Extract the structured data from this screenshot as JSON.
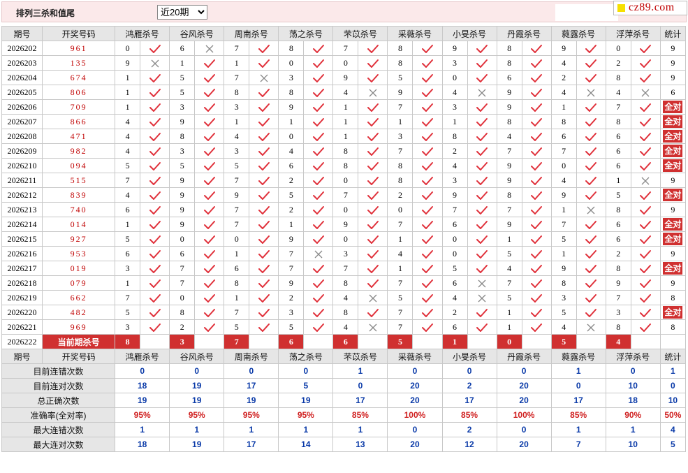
{
  "header": {
    "title": "排列三杀和值尾",
    "range_select": "近20期",
    "logo_text": "cz89.com"
  },
  "columns": {
    "period": "期号",
    "draw": "开奖号码",
    "experts": [
      "鸿雁杀号",
      "谷风杀号",
      "周南杀号",
      "荡之杀号",
      "芣苡杀号",
      "采薇杀号",
      "小旻杀号",
      "丹霞杀号",
      "蕤露杀号",
      "浮萍杀号"
    ],
    "total": "统计"
  },
  "rows": [
    {
      "period": "2026202",
      "draw": "961",
      "n": [
        0,
        6,
        7,
        8,
        7,
        8,
        9,
        8,
        9,
        0
      ],
      "ok": [
        1,
        0,
        1,
        1,
        1,
        1,
        1,
        1,
        1,
        1
      ],
      "total": "9"
    },
    {
      "period": "2026203",
      "draw": "135",
      "n": [
        9,
        1,
        1,
        0,
        0,
        8,
        3,
        8,
        4,
        2
      ],
      "ok": [
        0,
        1,
        1,
        1,
        1,
        1,
        1,
        1,
        1,
        1
      ],
      "total": "9"
    },
    {
      "period": "2026204",
      "draw": "674",
      "n": [
        1,
        5,
        7,
        3,
        9,
        5,
        0,
        6,
        2,
        8
      ],
      "ok": [
        1,
        1,
        0,
        1,
        1,
        1,
        1,
        1,
        1,
        1
      ],
      "total": "9"
    },
    {
      "period": "2026205",
      "draw": "806",
      "n": [
        1,
        5,
        8,
        8,
        4,
        9,
        4,
        9,
        4,
        4
      ],
      "ok": [
        1,
        1,
        1,
        1,
        0,
        1,
        0,
        1,
        0,
        0
      ],
      "total": "6"
    },
    {
      "period": "2026206",
      "draw": "709",
      "n": [
        1,
        3,
        3,
        9,
        1,
        7,
        3,
        9,
        1,
        7
      ],
      "ok": [
        1,
        1,
        1,
        1,
        1,
        1,
        1,
        1,
        1,
        1
      ],
      "total": "全对"
    },
    {
      "period": "2026207",
      "draw": "866",
      "n": [
        4,
        9,
        1,
        1,
        1,
        1,
        1,
        8,
        8,
        8
      ],
      "ok": [
        1,
        1,
        1,
        1,
        1,
        1,
        1,
        1,
        1,
        1
      ],
      "total": "全对"
    },
    {
      "period": "2026208",
      "draw": "471",
      "n": [
        4,
        8,
        4,
        0,
        1,
        3,
        8,
        4,
        6,
        6
      ],
      "ok": [
        1,
        1,
        1,
        1,
        1,
        1,
        1,
        1,
        1,
        1
      ],
      "total": "全对"
    },
    {
      "period": "2026209",
      "draw": "982",
      "n": [
        4,
        3,
        3,
        4,
        8,
        7,
        2,
        7,
        7,
        6
      ],
      "ok": [
        1,
        1,
        1,
        1,
        1,
        1,
        1,
        1,
        1,
        1
      ],
      "total": "全对"
    },
    {
      "period": "2026210",
      "draw": "094",
      "n": [
        5,
        5,
        5,
        6,
        8,
        8,
        4,
        9,
        0,
        6
      ],
      "ok": [
        1,
        1,
        1,
        1,
        1,
        1,
        1,
        1,
        1,
        1
      ],
      "total": "全对"
    },
    {
      "period": "2026211",
      "draw": "515",
      "n": [
        7,
        9,
        7,
        2,
        0,
        8,
        3,
        9,
        4,
        1
      ],
      "ok": [
        1,
        1,
        1,
        1,
        1,
        1,
        1,
        1,
        1,
        0
      ],
      "total": "9"
    },
    {
      "period": "2026212",
      "draw": "839",
      "n": [
        4,
        9,
        9,
        5,
        7,
        2,
        9,
        8,
        9,
        5
      ],
      "ok": [
        1,
        1,
        1,
        1,
        1,
        1,
        1,
        1,
        1,
        1
      ],
      "total": "全对"
    },
    {
      "period": "2026213",
      "draw": "740",
      "n": [
        6,
        9,
        7,
        2,
        0,
        0,
        7,
        7,
        1,
        8
      ],
      "ok": [
        1,
        1,
        1,
        1,
        1,
        1,
        1,
        1,
        0,
        1
      ],
      "total": "9"
    },
    {
      "period": "2026214",
      "draw": "014",
      "n": [
        1,
        9,
        7,
        1,
        9,
        7,
        6,
        9,
        7,
        6
      ],
      "ok": [
        1,
        1,
        1,
        1,
        1,
        1,
        1,
        1,
        1,
        1
      ],
      "total": "全对"
    },
    {
      "period": "2026215",
      "draw": "927",
      "n": [
        5,
        0,
        0,
        9,
        0,
        1,
        0,
        1,
        5,
        6
      ],
      "ok": [
        1,
        1,
        1,
        1,
        1,
        1,
        1,
        1,
        1,
        1
      ],
      "total": "全对"
    },
    {
      "period": "2026216",
      "draw": "953",
      "n": [
        6,
        6,
        1,
        7,
        3,
        4,
        0,
        5,
        1,
        2
      ],
      "ok": [
        1,
        1,
        1,
        0,
        1,
        1,
        1,
        1,
        1,
        1
      ],
      "total": "9"
    },
    {
      "period": "2026217",
      "draw": "019",
      "n": [
        3,
        7,
        6,
        7,
        7,
        1,
        5,
        4,
        9,
        8
      ],
      "ok": [
        1,
        1,
        1,
        1,
        1,
        1,
        1,
        1,
        1,
        1
      ],
      "total": "全对"
    },
    {
      "period": "2026218",
      "draw": "079",
      "n": [
        1,
        7,
        8,
        9,
        8,
        7,
        6,
        7,
        8,
        9
      ],
      "ok": [
        1,
        1,
        1,
        1,
        1,
        1,
        0,
        1,
        1,
        1
      ],
      "total": "9"
    },
    {
      "period": "2026219",
      "draw": "662",
      "n": [
        7,
        0,
        1,
        2,
        4,
        5,
        4,
        5,
        3,
        7
      ],
      "ok": [
        1,
        1,
        1,
        1,
        0,
        1,
        0,
        1,
        1,
        1
      ],
      "total": "8"
    },
    {
      "period": "2026220",
      "draw": "482",
      "n": [
        5,
        8,
        7,
        3,
        8,
        7,
        2,
        1,
        5,
        3
      ],
      "ok": [
        1,
        1,
        1,
        1,
        1,
        1,
        1,
        1,
        1,
        1
      ],
      "total": "全对"
    },
    {
      "period": "2026221",
      "draw": "969",
      "n": [
        3,
        2,
        5,
        5,
        4,
        7,
        6,
        1,
        4,
        8
      ],
      "ok": [
        1,
        1,
        1,
        1,
        0,
        1,
        1,
        1,
        0,
        1
      ],
      "total": "8"
    }
  ],
  "current": {
    "period": "2026222",
    "label": "当前期杀号",
    "kills": [
      "8",
      "3",
      "7",
      "6",
      "6",
      "5",
      "1",
      "0",
      "5",
      "4"
    ]
  },
  "stats": [
    {
      "label": "目前连错次数",
      "values": [
        "0",
        "0",
        "0",
        "0",
        "1",
        "0",
        "0",
        "0",
        "1",
        "0",
        "1"
      ]
    },
    {
      "label": "目前连对次数",
      "values": [
        "18",
        "19",
        "17",
        "5",
        "0",
        "20",
        "2",
        "20",
        "0",
        "10",
        "0"
      ]
    },
    {
      "label": "总正确次数",
      "values": [
        "19",
        "19",
        "19",
        "19",
        "17",
        "20",
        "17",
        "20",
        "17",
        "18",
        "10"
      ]
    },
    {
      "label": "准确率(全对率)",
      "values": [
        "95%",
        "95%",
        "95%",
        "95%",
        "85%",
        "100%",
        "85%",
        "100%",
        "85%",
        "90%",
        "50%"
      ],
      "red": true
    },
    {
      "label": "最大连错次数",
      "values": [
        "1",
        "1",
        "1",
        "1",
        "1",
        "0",
        "2",
        "0",
        "1",
        "1",
        "4"
      ]
    },
    {
      "label": "最大连对次数",
      "values": [
        "18",
        "19",
        "17",
        "14",
        "13",
        "20",
        "12",
        "20",
        "7",
        "10",
        "5"
      ]
    }
  ],
  "colors": {
    "tick": "#e0303a",
    "cross": "#888888",
    "kill": "#d03030",
    "stat_blue": "#0a3aa8",
    "stat_red": "#d02020"
  }
}
